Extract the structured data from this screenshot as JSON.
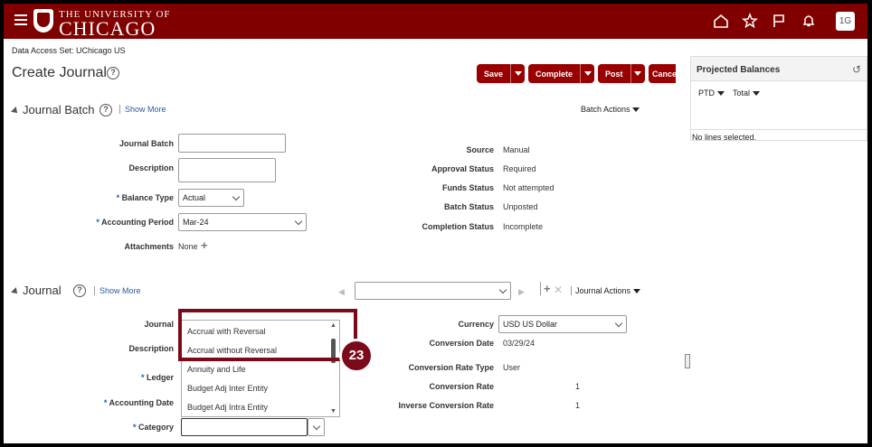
{
  "header": {
    "logo_top": "THE UNIVERSITY OF",
    "logo_main": "CHICAGO",
    "avatar": "1G",
    "icons": [
      "menu-icon",
      "home-icon",
      "star-icon",
      "flag-icon",
      "bell-icon"
    ]
  },
  "page": {
    "data_access": "Data Access Set: UChicago US",
    "title": "Create Journal",
    "help": "?"
  },
  "toolbar": {
    "save": "Save",
    "complete": "Complete",
    "post": "Post",
    "cancel": "Cance"
  },
  "projected_balances": {
    "title": "Projected Balances",
    "ptd": "PTD",
    "total": "Total",
    "empty": "No lines selected."
  },
  "journal_batch": {
    "title": "Journal Batch",
    "show_more": "Show More",
    "batch_actions": "Batch Actions",
    "labels": {
      "journal_batch": "Journal Batch",
      "description": "Description",
      "balance_type": "Balance Type",
      "accounting_period": "Accounting Period",
      "attachments": "Attachments"
    },
    "values": {
      "journal_batch": "",
      "description": "",
      "balance_type": "Actual",
      "accounting_period": "Mar-24",
      "attachments": "None"
    },
    "status": {
      "source_label": "Source",
      "source": "Manual",
      "approval_label": "Approval Status",
      "approval": "Required",
      "funds_label": "Funds Status",
      "funds": "Not attempted",
      "batch_label": "Batch Status",
      "batch": "Unposted",
      "completion_label": "Completion Status",
      "completion": "Incomplete"
    }
  },
  "journal": {
    "title": "Journal",
    "show_more": "Show More",
    "journal_actions": "Journal Actions",
    "labels": {
      "journal": "Journal",
      "description": "Description",
      "ledger": "Ledger",
      "accounting_date": "Accounting Date",
      "category": "Category",
      "currency": "Currency",
      "conversion_date": "Conversion Date",
      "conversion_rate_type": "Conversion Rate Type",
      "conversion_rate": "Conversion Rate",
      "inverse_conversion_rate": "Inverse Conversion Rate"
    },
    "values": {
      "currency": "USD US Dollar",
      "conversion_date": "03/29/24",
      "conversion_rate_type": "User",
      "conversion_rate": "1",
      "inverse_conversion_rate": "1",
      "category": ""
    }
  },
  "category_dropdown": {
    "options": [
      "Accrual with Reversal",
      "Accrual without Reversal",
      "Annuity and Life",
      "Budget Adj Inter Entity",
      "Budget Adj Intra Entity"
    ]
  },
  "callout": {
    "step": "23"
  }
}
